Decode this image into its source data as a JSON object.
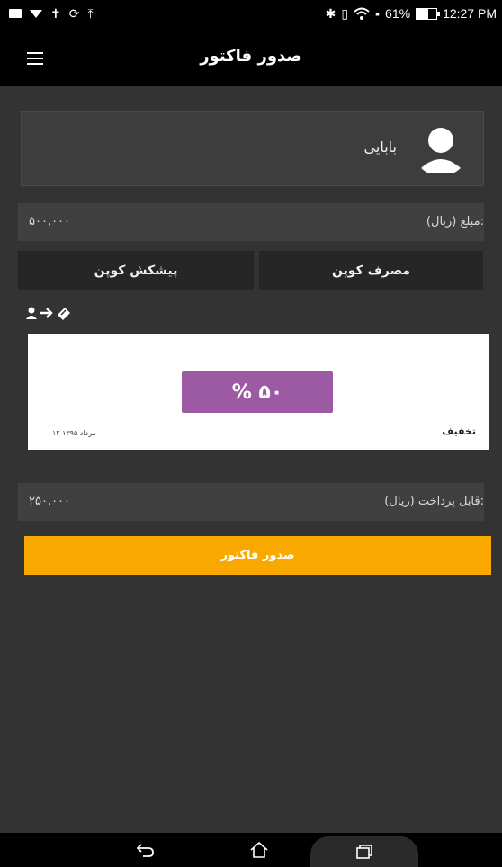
{
  "status_bar": {
    "battery": "61%",
    "time": "12:27 PM",
    "icons": [
      "mail-icon",
      "signal-down-icon",
      "fan-icon",
      "sync-icon",
      "upload-icon",
      "bluetooth-icon",
      "vibrate-icon",
      "wifi-icon",
      "sim-icon"
    ]
  },
  "app_bar": {
    "title": "صدور فاکتور",
    "menu_icon": "hamburger-icon"
  },
  "profile": {
    "name": "بابایی",
    "avatar_icon": "user-avatar-icon"
  },
  "amount": {
    "label": "مبلغ (ریال):",
    "value": "۵۰۰,۰۰۰"
  },
  "coupon_buttons": {
    "use_label": "مصرف کوپن",
    "offer_label": "پیشکش کوپن"
  },
  "transfer": {
    "icons": [
      "user-icon",
      "arrow-right-icon",
      "ticket-icon"
    ]
  },
  "coupon": {
    "discount": "۵۰ %",
    "type": "تخفیف",
    "date": "۱۲ مرداد ۱۳۹۵",
    "badge_color": "#9b5aa3"
  },
  "payable": {
    "label": "قابل پرداخت (ریال):",
    "value": "۲۵۰,۰۰۰"
  },
  "issue_button": {
    "label": "صدور فاکتور",
    "color": "#f9a800"
  },
  "nav": {
    "icons": [
      "back-icon",
      "home-icon",
      "recent-apps-icon"
    ]
  }
}
